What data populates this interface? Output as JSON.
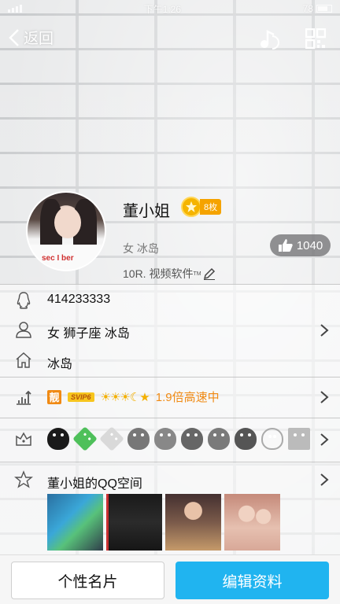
{
  "status_bar": {
    "time": "下午1:26",
    "battery": "78"
  },
  "nav": {
    "back_label": "返回",
    "icons": [
      "music-note-icon",
      "qr-code-icon"
    ]
  },
  "profile": {
    "name": "董小姐",
    "badge_count": "8枚",
    "gender_location": "女  冰岛",
    "signature": "10R. 视频软件",
    "signature_tm": "TM",
    "likes": "1040",
    "avatar_shirt_text": "sec I ber"
  },
  "rows": {
    "qq_number": "414233333",
    "info": "女  狮子座  冰岛",
    "hometown": "冰岛",
    "vip": {
      "beauty_label": "靓",
      "svip_label": "SVIP6",
      "level_icons": "☀☀☀☾★",
      "speed_text": "1.9倍高速中"
    },
    "qzone_title": "董小姐的QQ空间"
  },
  "bottom": {
    "card_button": "个性名片",
    "edit_button": "编辑资料"
  },
  "colors": {
    "accent": "#20b4f0",
    "badge": "#f5a300",
    "speed": "#f08a14"
  }
}
